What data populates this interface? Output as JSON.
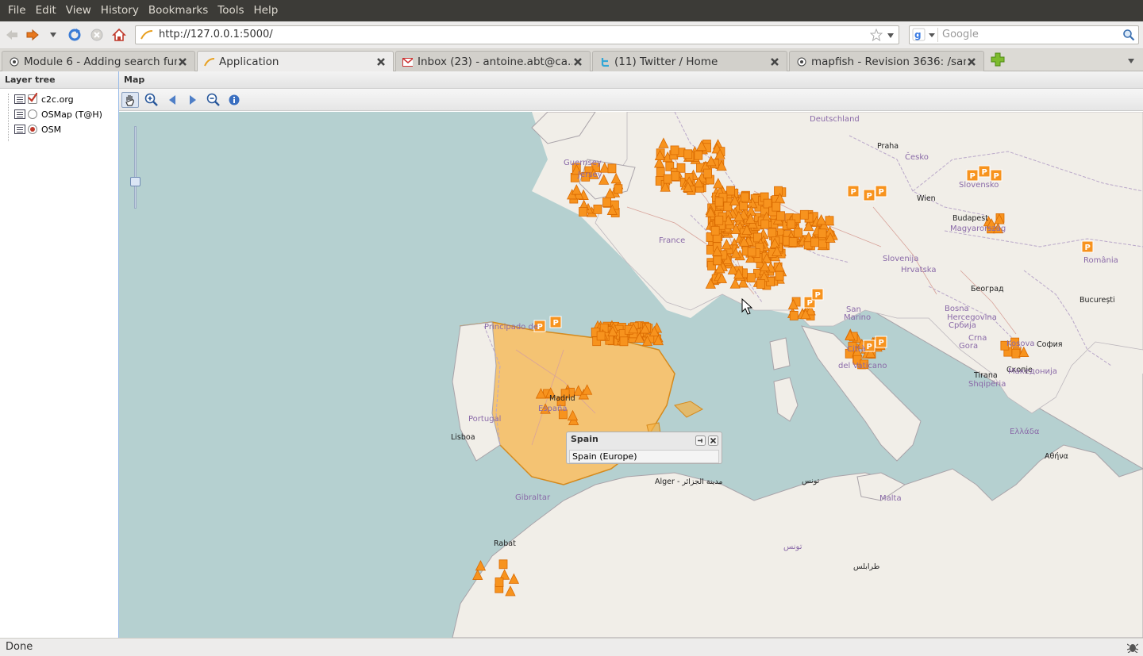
{
  "menu": {
    "items": [
      "File",
      "Edit",
      "View",
      "History",
      "Bookmarks",
      "Tools",
      "Help"
    ]
  },
  "nav": {
    "url": "http://127.0.0.1:5000/",
    "search_placeholder": "Google"
  },
  "tabs": [
    {
      "title": "Module 6 - Adding search fun...",
      "icon": "page-icon"
    },
    {
      "title": "Application",
      "icon": "loading-icon"
    },
    {
      "title": "Inbox (23) - antoine.abt@ca...",
      "icon": "gmail-icon"
    },
    {
      "title": "(11) Twitter / Home",
      "icon": "twitter-icon"
    },
    {
      "title": "mapfish - Revision 3636: /san...",
      "icon": "page-icon"
    }
  ],
  "layer_tree": {
    "title": "Layer tree",
    "nodes": [
      {
        "label": "c2c.org",
        "type": "checkbox",
        "checked": true
      },
      {
        "label": "OSMap (T@H)",
        "type": "radio",
        "checked": false
      },
      {
        "label": "OSM",
        "type": "radio",
        "checked": true
      }
    ]
  },
  "map": {
    "title": "Map",
    "tools": [
      "pan-icon",
      "zoom-in-icon",
      "history-back-icon",
      "history-forward-icon",
      "zoom-out-icon",
      "info-icon"
    ],
    "labels": [
      {
        "text": "Deutschland",
        "cls": "country"
      },
      {
        "text": "Praha",
        "cls": "city"
      },
      {
        "text": "Česko",
        "cls": "country"
      },
      {
        "text": "Wien",
        "cls": "city"
      },
      {
        "text": "Budapest",
        "cls": "city"
      },
      {
        "text": "Magyarország",
        "cls": "country"
      },
      {
        "text": "Slovensko",
        "cls": "country"
      },
      {
        "text": "România",
        "cls": "country"
      },
      {
        "text": "București",
        "cls": "city"
      },
      {
        "text": "Hrvatska",
        "cls": "country"
      },
      {
        "text": "Београд",
        "cls": "city"
      },
      {
        "text": "Bosna",
        "cls": "country"
      },
      {
        "text": "Hercegovina",
        "cls": "country"
      },
      {
        "text": "Србија",
        "cls": "country"
      },
      {
        "text": "Crna",
        "cls": "country"
      },
      {
        "text": "Gora",
        "cls": "country"
      },
      {
        "text": "Kosova",
        "cls": "country"
      },
      {
        "text": "София",
        "cls": "city"
      },
      {
        "text": "Скопје",
        "cls": "city"
      },
      {
        "text": "Македонија",
        "cls": "country"
      },
      {
        "text": "Tirana",
        "cls": "city"
      },
      {
        "text": "Shqipëria",
        "cls": "country"
      },
      {
        "text": "Ελλάδα",
        "cls": "country"
      },
      {
        "text": "Αθήνα",
        "cls": "city"
      },
      {
        "text": "France",
        "cls": "country"
      },
      {
        "text": "Guernsey",
        "cls": "country"
      },
      {
        "text": "Jersey",
        "cls": "country"
      },
      {
        "text": "Principado de",
        "cls": "country"
      },
      {
        "text": "Madrid",
        "cls": "city"
      },
      {
        "text": "España",
        "cls": "country"
      },
      {
        "text": "Portugal",
        "cls": "country"
      },
      {
        "text": "Lisboa",
        "cls": "city"
      },
      {
        "text": "Gibraltar",
        "cls": "country"
      },
      {
        "text": "Alger - مدينة الجزائر",
        "cls": "city"
      },
      {
        "text": "تونس",
        "cls": "city"
      },
      {
        "text": "تونس",
        "cls": "country"
      },
      {
        "text": "طرابلس",
        "cls": "city"
      },
      {
        "text": "Malta",
        "cls": "country"
      },
      {
        "text": "Rabat",
        "cls": "city"
      },
      {
        "text": "San",
        "cls": "country"
      },
      {
        "text": "Marino",
        "cls": "country"
      },
      {
        "text": "Città",
        "cls": "country"
      },
      {
        "text": "del Vaticano",
        "cls": "country"
      },
      {
        "text": "Slovenija",
        "cls": "country"
      }
    ],
    "popup": {
      "title": "Spain",
      "body": "Spain (Europe)"
    }
  },
  "status": {
    "text": "Done"
  },
  "colors": {
    "marker": "#f7931e",
    "marker_dark": "#d96a00",
    "highlight": "#f5b041",
    "sea": "#b5d0d0",
    "land": "#f1eee8"
  }
}
